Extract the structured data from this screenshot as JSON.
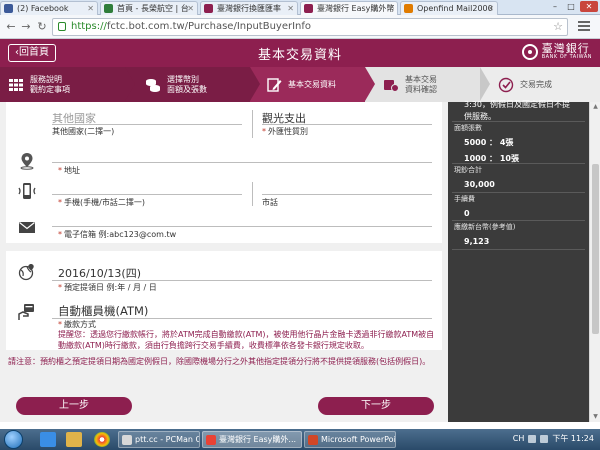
{
  "browser": {
    "tabs": [
      {
        "label": "(2) Facebook",
        "color": "#3b5998"
      },
      {
        "label": "首頁 - 長榮航空 | 台",
        "color": "#2f7d3a"
      },
      {
        "label": "臺灣銀行換匯匯率",
        "color": "#8d1f4f"
      },
      {
        "label": "臺灣銀行 Easy購外幣",
        "color": "#8d1f4f"
      },
      {
        "label": "Openfind Mail2000",
        "color": "#e07b00"
      }
    ],
    "url_scheme": "https://",
    "url_rest": "fctc.bot.com.tw/Purchase/InputBuyerInfo"
  },
  "header": {
    "home_label": "回首頁",
    "title": "基本交易資料",
    "bank_name": "臺灣銀行",
    "bank_name_en": "BANK OF TAIWAN"
  },
  "steps": [
    {
      "line1": "服務說明",
      "line2": "觀約定事項"
    },
    {
      "line1": "選擇幣別",
      "line2": "面額及張數"
    },
    {
      "line1": "基本交易資料",
      "line2": ""
    },
    {
      "line1": "基本交易",
      "line2": "資料確認"
    },
    {
      "line1": "交易完成",
      "line2": ""
    }
  ],
  "form": {
    "country_value": "其他國家",
    "country_label": "其他國家(二擇一)",
    "purpose_value": "觀光支出",
    "purpose_label": "外匯性質別",
    "address_label": "地址",
    "phone_label": "手機(手機/市話二擇一)",
    "landline_label": "市話",
    "email_label": "電子信箱 例:abc123@com.tw",
    "pickup_date_value": "2016/10/13(四)",
    "pickup_date_label": "預定提領日 例:年 / 月 / 日",
    "pay_method_value": "自動櫃員機(ATM)",
    "pay_method_label": "繳款方式",
    "pay_notice": "提醒您：透過您行繳款帳行，將於ATM完成自動繳款(ATM)，被使用他行晶片金融卡透過非行繳款ATM被自動繳款(ATM)時行繳款，須由行負擔跨行交易手續費，收費標準依各發卡銀行規定收取。",
    "bottom_note": "請注意：預約櫃之預定提領日期為國定例假日，除國際機場分行之外其他指定提領分行將不提供提領服務(包括例假日)。",
    "prev_label": "上一步",
    "next_label": "下一步"
  },
  "summary": {
    "top_text": "3:30，例假日及國定假日不提",
    "top_text2": "供服務。",
    "denom_label": "面額張數",
    "denom_1": "5000 ： 4張",
    "denom_2": "1000 ： 10張",
    "subtotal_label": "現鈔合計",
    "subtotal": "30,000",
    "fee_label": "手續費",
    "fee": "0",
    "twd_label": "應繳新台幣(參考值)",
    "twd": "9,123"
  },
  "taskbar": {
    "tasks": [
      "ptt.cc - PCMan Co...",
      "臺灣銀行 Easy購外...",
      "Microsoft PowerPoi..."
    ],
    "lang": "CH",
    "clock": "下午 11:24"
  }
}
